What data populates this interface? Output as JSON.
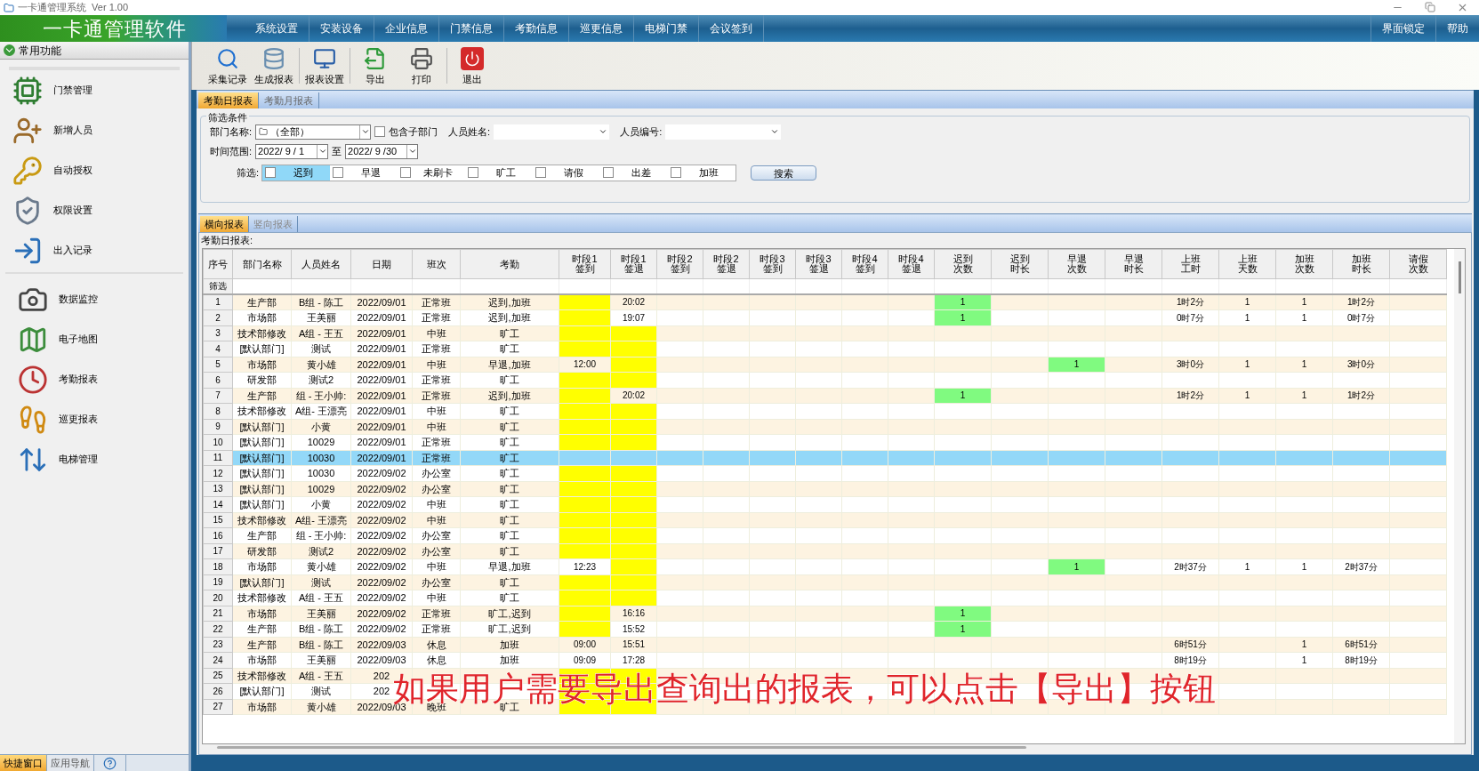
{
  "window": {
    "title": "一卡通管理系统  Ver 1.00"
  },
  "menu": {
    "logo": "一卡通管理软件",
    "items": [
      "系统设置",
      "安装设备",
      "企业信息",
      "门禁信息",
      "考勤信息",
      "巡更信息",
      "电梯门禁",
      "会议签到"
    ],
    "right_items": [
      "界面锁定",
      "帮助"
    ]
  },
  "sidebar": {
    "header": "常用功能",
    "groups": [
      [
        "门禁管理",
        "新增人员",
        "自动授权",
        "权限设置",
        "出入记录"
      ],
      [
        "数据监控",
        "电子地图",
        "考勤报表",
        "巡更报表",
        "电梯管理"
      ]
    ],
    "bottom_tabs": [
      {
        "label": "快捷窗口",
        "selected": true
      },
      {
        "label": "应用导航",
        "selected": false
      }
    ]
  },
  "toolbar": [
    "采集记录",
    "生成报表",
    "报表设置",
    "导出",
    "打印",
    "退出"
  ],
  "report_tabs": [
    {
      "label": "考勤日报表",
      "selected": true
    },
    {
      "label": "考勤月报表",
      "selected": false
    }
  ],
  "filters": {
    "title": "筛选条件",
    "dept_label": "部门名称:",
    "dept_value": "（全部）",
    "include_sub": {
      "label": "包含子部门",
      "checked": false
    },
    "name_label": "人员姓名:",
    "number_label": "人员编号:",
    "range_label": "时间范围:",
    "date_from": "2022/ 9 / 1",
    "to_label": "至",
    "date_to": "2022/ 9 /30",
    "filter_label": "筛选:",
    "options": [
      {
        "label": "迟到",
        "checked": false,
        "highlighted": true
      },
      {
        "label": "早退",
        "checked": false,
        "highlighted": false
      },
      {
        "label": "未刷卡",
        "checked": false,
        "highlighted": false
      },
      {
        "label": "旷工",
        "checked": false,
        "highlighted": false
      },
      {
        "label": "请假",
        "checked": false,
        "highlighted": false
      },
      {
        "label": "出差",
        "checked": false,
        "highlighted": false
      },
      {
        "label": "加班",
        "checked": false,
        "highlighted": false
      }
    ],
    "search_button": "搜索"
  },
  "view_tabs": [
    {
      "label": "横向报表",
      "selected": true
    },
    {
      "label": "竖向报表",
      "selected": false
    }
  ],
  "table": {
    "title": "考勤日报表:",
    "filter_row_label": "筛选",
    "columns": [
      {
        "lines": [
          "序号"
        ]
      },
      {
        "lines": [
          "部门名称"
        ]
      },
      {
        "lines": [
          "人员姓名"
        ]
      },
      {
        "lines": [
          "日期"
        ]
      },
      {
        "lines": [
          "班次"
        ]
      },
      {
        "lines": [
          "考勤"
        ]
      },
      {
        "lines": [
          "时段1",
          "签到"
        ]
      },
      {
        "lines": [
          "时段1",
          "签退"
        ]
      },
      {
        "lines": [
          "时段2",
          "签到"
        ]
      },
      {
        "lines": [
          "时段2",
          "签退"
        ]
      },
      {
        "lines": [
          "时段3",
          "签到"
        ]
      },
      {
        "lines": [
          "时段3",
          "签退"
        ]
      },
      {
        "lines": [
          "时段4",
          "签到"
        ]
      },
      {
        "lines": [
          "时段4",
          "签退"
        ]
      },
      {
        "lines": [
          "迟到",
          "次数"
        ]
      },
      {
        "lines": [
          "迟到",
          "时长"
        ]
      },
      {
        "lines": [
          "早退",
          "次数"
        ]
      },
      {
        "lines": [
          "早退",
          "时长"
        ]
      },
      {
        "lines": [
          "上班",
          "工时"
        ]
      },
      {
        "lines": [
          "上班",
          "天数"
        ]
      },
      {
        "lines": [
          "加班",
          "次数"
        ]
      },
      {
        "lines": [
          "加班",
          "时长"
        ]
      },
      {
        "lines": [
          "请假",
          "次数"
        ]
      }
    ],
    "rows": [
      {
        "selected": false,
        "cells": [
          {
            "text": "1"
          },
          {
            "text": "生产部"
          },
          {
            "text": "B组 - 陈工"
          },
          {
            "text": "2022/09/01"
          },
          {
            "text": "正常班"
          },
          {
            "text": "迟到,加班"
          },
          {
            "color": "#ffff00"
          },
          {
            "text": "20:02"
          },
          {},
          {},
          {},
          {},
          {},
          {},
          {
            "text": "1",
            "color": "#80fa80"
          },
          {},
          {},
          {},
          {
            "text": "1时2分"
          },
          {
            "text": "1"
          },
          {
            "text": "1"
          },
          {
            "text": "1时2分"
          },
          {}
        ]
      },
      {
        "selected": false,
        "cells": [
          {
            "text": "2"
          },
          {
            "text": "市场部"
          },
          {
            "text": "王美丽"
          },
          {
            "text": "2022/09/01"
          },
          {
            "text": "正常班"
          },
          {
            "text": "迟到,加班"
          },
          {
            "color": "#ffff00"
          },
          {
            "text": "19:07"
          },
          {},
          {},
          {},
          {},
          {},
          {},
          {
            "text": "1",
            "color": "#80fa80"
          },
          {},
          {},
          {},
          {
            "text": "0时7分"
          },
          {
            "text": "1"
          },
          {
            "text": "1"
          },
          {
            "text": "0时7分"
          },
          {}
        ]
      },
      {
        "selected": false,
        "cells": [
          {
            "text": "3"
          },
          {
            "text": "技术部修改"
          },
          {
            "text": "A组 - 王五"
          },
          {
            "text": "2022/09/01"
          },
          {
            "text": "中班"
          },
          {
            "text": "旷工"
          },
          {
            "color": "#ffff00"
          },
          {
            "color": "#ffff00"
          },
          {},
          {},
          {},
          {},
          {},
          {},
          {},
          {},
          {},
          {},
          {},
          {},
          {},
          {},
          {}
        ]
      },
      {
        "selected": false,
        "cells": [
          {
            "text": "4"
          },
          {
            "text": "[默认部门]"
          },
          {
            "text": "测试"
          },
          {
            "text": "2022/09/01"
          },
          {
            "text": "正常班"
          },
          {
            "text": "旷工"
          },
          {
            "color": "#ffff00"
          },
          {
            "color": "#ffff00"
          },
          {},
          {},
          {},
          {},
          {},
          {},
          {},
          {},
          {},
          {},
          {},
          {},
          {},
          {},
          {}
        ]
      },
      {
        "selected": false,
        "cells": [
          {
            "text": "5"
          },
          {
            "text": "市场部"
          },
          {
            "text": "黄小雄"
          },
          {
            "text": "2022/09/01"
          },
          {
            "text": "中班"
          },
          {
            "text": "早退,加班"
          },
          {
            "text": "12:00"
          },
          {
            "color": "#ffff00"
          },
          {},
          {},
          {},
          {},
          {},
          {},
          {},
          {},
          {
            "text": "1",
            "color": "#80fa80"
          },
          {},
          {
            "text": "3时0分"
          },
          {
            "text": "1"
          },
          {
            "text": "1"
          },
          {
            "text": "3时0分"
          },
          {}
        ]
      },
      {
        "selected": false,
        "cells": [
          {
            "text": "6"
          },
          {
            "text": "研发部"
          },
          {
            "text": "测试2"
          },
          {
            "text": "2022/09/01"
          },
          {
            "text": "正常班"
          },
          {
            "text": "旷工"
          },
          {
            "color": "#ffff00"
          },
          {
            "color": "#ffff00"
          },
          {},
          {},
          {},
          {},
          {},
          {},
          {},
          {},
          {},
          {},
          {},
          {},
          {},
          {},
          {}
        ]
      },
      {
        "selected": false,
        "cells": [
          {
            "text": "7"
          },
          {
            "text": "生产部"
          },
          {
            "text": "组 - 王小帅:"
          },
          {
            "text": "2022/09/01"
          },
          {
            "text": "正常班"
          },
          {
            "text": "迟到,加班"
          },
          {
            "color": "#ffff00"
          },
          {
            "text": "20:02"
          },
          {},
          {},
          {},
          {},
          {},
          {},
          {
            "text": "1",
            "color": "#80fa80"
          },
          {},
          {},
          {},
          {
            "text": "1时2分"
          },
          {
            "text": "1"
          },
          {
            "text": "1"
          },
          {
            "text": "1时2分"
          },
          {}
        ]
      },
      {
        "selected": false,
        "cells": [
          {
            "text": "8"
          },
          {
            "text": "技术部修改"
          },
          {
            "text": "A组- 王漂亮"
          },
          {
            "text": "2022/09/01"
          },
          {
            "text": "中班"
          },
          {
            "text": "旷工"
          },
          {
            "color": "#ffff00"
          },
          {
            "color": "#ffff00"
          },
          {},
          {},
          {},
          {},
          {},
          {},
          {},
          {},
          {},
          {},
          {},
          {},
          {},
          {},
          {}
        ]
      },
      {
        "selected": false,
        "cells": [
          {
            "text": "9"
          },
          {
            "text": "[默认部门]"
          },
          {
            "text": "小黄"
          },
          {
            "text": "2022/09/01"
          },
          {
            "text": "中班"
          },
          {
            "text": "旷工"
          },
          {
            "color": "#ffff00"
          },
          {
            "color": "#ffff00"
          },
          {},
          {},
          {},
          {},
          {},
          {},
          {},
          {},
          {},
          {},
          {},
          {},
          {},
          {},
          {}
        ]
      },
      {
        "selected": false,
        "cells": [
          {
            "text": "10"
          },
          {
            "text": "[默认部门]"
          },
          {
            "text": "10029"
          },
          {
            "text": "2022/09/01"
          },
          {
            "text": "正常班"
          },
          {
            "text": "旷工"
          },
          {
            "color": "#ffff00"
          },
          {
            "color": "#ffff00"
          },
          {},
          {},
          {},
          {},
          {},
          {},
          {},
          {},
          {},
          {},
          {},
          {},
          {},
          {},
          {}
        ]
      },
      {
        "selected": true,
        "cells": [
          {
            "text": "11"
          },
          {
            "text": "[默认部门]"
          },
          {
            "text": "10030"
          },
          {
            "text": "2022/09/01"
          },
          {
            "text": "正常班"
          },
          {
            "text": "旷工"
          },
          {},
          {},
          {},
          {},
          {},
          {},
          {},
          {},
          {},
          {},
          {},
          {},
          {},
          {},
          {},
          {},
          {}
        ]
      },
      {
        "selected": false,
        "cells": [
          {
            "text": "12"
          },
          {
            "text": "[默认部门]"
          },
          {
            "text": "10030"
          },
          {
            "text": "2022/09/02"
          },
          {
            "text": "办公室"
          },
          {
            "text": "旷工"
          },
          {
            "color": "#ffff00"
          },
          {
            "color": "#ffff00"
          },
          {},
          {},
          {},
          {},
          {},
          {},
          {},
          {},
          {},
          {},
          {},
          {},
          {},
          {},
          {}
        ]
      },
      {
        "selected": false,
        "cells": [
          {
            "text": "13"
          },
          {
            "text": "[默认部门]"
          },
          {
            "text": "10029"
          },
          {
            "text": "2022/09/02"
          },
          {
            "text": "办公室"
          },
          {
            "text": "旷工"
          },
          {
            "color": "#ffff00"
          },
          {
            "color": "#ffff00"
          },
          {},
          {},
          {},
          {},
          {},
          {},
          {},
          {},
          {},
          {},
          {},
          {},
          {},
          {},
          {}
        ]
      },
      {
        "selected": false,
        "cells": [
          {
            "text": "14"
          },
          {
            "text": "[默认部门]"
          },
          {
            "text": "小黄"
          },
          {
            "text": "2022/09/02"
          },
          {
            "text": "中班"
          },
          {
            "text": "旷工"
          },
          {
            "color": "#ffff00"
          },
          {
            "color": "#ffff00"
          },
          {},
          {},
          {},
          {},
          {},
          {},
          {},
          {},
          {},
          {},
          {},
          {},
          {},
          {},
          {}
        ]
      },
      {
        "selected": false,
        "cells": [
          {
            "text": "15"
          },
          {
            "text": "技术部修改"
          },
          {
            "text": "A组- 王漂亮"
          },
          {
            "text": "2022/09/02"
          },
          {
            "text": "中班"
          },
          {
            "text": "旷工"
          },
          {
            "color": "#ffff00"
          },
          {
            "color": "#ffff00"
          },
          {},
          {},
          {},
          {},
          {},
          {},
          {},
          {},
          {},
          {},
          {},
          {},
          {},
          {},
          {}
        ]
      },
      {
        "selected": false,
        "cells": [
          {
            "text": "16"
          },
          {
            "text": "生产部"
          },
          {
            "text": "组 - 王小帅:"
          },
          {
            "text": "2022/09/02"
          },
          {
            "text": "办公室"
          },
          {
            "text": "旷工"
          },
          {
            "color": "#ffff00"
          },
          {
            "color": "#ffff00"
          },
          {},
          {},
          {},
          {},
          {},
          {},
          {},
          {},
          {},
          {},
          {},
          {},
          {},
          {},
          {}
        ]
      },
      {
        "selected": false,
        "cells": [
          {
            "text": "17"
          },
          {
            "text": "研发部"
          },
          {
            "text": "测试2"
          },
          {
            "text": "2022/09/02"
          },
          {
            "text": "办公室"
          },
          {
            "text": "旷工"
          },
          {
            "color": "#ffff00"
          },
          {
            "color": "#ffff00"
          },
          {},
          {},
          {},
          {},
          {},
          {},
          {},
          {},
          {},
          {},
          {},
          {},
          {},
          {},
          {}
        ]
      },
      {
        "selected": false,
        "cells": [
          {
            "text": "18"
          },
          {
            "text": "市场部"
          },
          {
            "text": "黄小雄"
          },
          {
            "text": "2022/09/02"
          },
          {
            "text": "中班"
          },
          {
            "text": "早退,加班"
          },
          {
            "text": "12:23"
          },
          {
            "color": "#ffff00"
          },
          {},
          {},
          {},
          {},
          {},
          {},
          {},
          {},
          {
            "text": "1",
            "color": "#80fa80"
          },
          {},
          {
            "text": "2时37分"
          },
          {
            "text": "1"
          },
          {
            "text": "1"
          },
          {
            "text": "2时37分"
          },
          {}
        ]
      },
      {
        "selected": false,
        "cells": [
          {
            "text": "19"
          },
          {
            "text": "[默认部门]"
          },
          {
            "text": "测试"
          },
          {
            "text": "2022/09/02"
          },
          {
            "text": "办公室"
          },
          {
            "text": "旷工"
          },
          {
            "color": "#ffff00"
          },
          {
            "color": "#ffff00"
          },
          {},
          {},
          {},
          {},
          {},
          {},
          {},
          {},
          {},
          {},
          {},
          {},
          {},
          {},
          {}
        ]
      },
      {
        "selected": false,
        "cells": [
          {
            "text": "20"
          },
          {
            "text": "技术部修改"
          },
          {
            "text": "A组 - 王五"
          },
          {
            "text": "2022/09/02"
          },
          {
            "text": "中班"
          },
          {
            "text": "旷工"
          },
          {
            "color": "#ffff00"
          },
          {
            "color": "#ffff00"
          },
          {},
          {},
          {},
          {},
          {},
          {},
          {},
          {},
          {},
          {},
          {},
          {},
          {},
          {},
          {}
        ]
      },
      {
        "selected": false,
        "cells": [
          {
            "text": "21"
          },
          {
            "text": "市场部"
          },
          {
            "text": "王美丽"
          },
          {
            "text": "2022/09/02"
          },
          {
            "text": "正常班"
          },
          {
            "text": "旷工,迟到"
          },
          {
            "color": "#ffff00"
          },
          {
            "text": "16:16"
          },
          {},
          {},
          {},
          {},
          {},
          {},
          {
            "text": "1",
            "color": "#80fa80"
          },
          {},
          {},
          {},
          {},
          {},
          {},
          {},
          {}
        ]
      },
      {
        "selected": false,
        "cells": [
          {
            "text": "22"
          },
          {
            "text": "生产部"
          },
          {
            "text": "B组 - 陈工"
          },
          {
            "text": "2022/09/02"
          },
          {
            "text": "正常班"
          },
          {
            "text": "旷工,迟到"
          },
          {
            "color": "#ffff00"
          },
          {
            "text": "15:52"
          },
          {},
          {},
          {},
          {},
          {},
          {},
          {
            "text": "1",
            "color": "#80fa80"
          },
          {},
          {},
          {},
          {},
          {},
          {},
          {},
          {}
        ]
      },
      {
        "selected": false,
        "cells": [
          {
            "text": "23"
          },
          {
            "text": "生产部"
          },
          {
            "text": "B组 - 陈工"
          },
          {
            "text": "2022/09/03"
          },
          {
            "text": "休息"
          },
          {
            "text": "加班"
          },
          {
            "text": "09:00"
          },
          {
            "text": "15:51"
          },
          {},
          {},
          {},
          {},
          {},
          {},
          {},
          {},
          {},
          {},
          {
            "text": "6时51分"
          },
          {},
          {
            "text": "1"
          },
          {
            "text": "6时51分"
          },
          {}
        ]
      },
      {
        "selected": false,
        "cells": [
          {
            "text": "24"
          },
          {
            "text": "市场部"
          },
          {
            "text": "王美丽"
          },
          {
            "text": "2022/09/03"
          },
          {
            "text": "休息"
          },
          {
            "text": "加班"
          },
          {
            "text": "09:09"
          },
          {
            "text": "17:28"
          },
          {},
          {},
          {},
          {},
          {},
          {},
          {},
          {},
          {},
          {},
          {
            "text": "8时19分"
          },
          {},
          {
            "text": "1"
          },
          {
            "text": "8时19分"
          },
          {}
        ]
      },
      {
        "selected": false,
        "cells": [
          {
            "text": "25"
          },
          {
            "text": "技术部修改"
          },
          {
            "text": "A组 - 王五"
          },
          {
            "text": "202"
          },
          {},
          {},
          {
            "color": "#ffff00"
          },
          {
            "color": "#ffff00"
          },
          {},
          {},
          {},
          {},
          {},
          {},
          {},
          {},
          {},
          {},
          {},
          {},
          {},
          {},
          {}
        ]
      },
      {
        "selected": false,
        "cells": [
          {
            "text": "26"
          },
          {
            "text": "[默认部门]"
          },
          {
            "text": "测试"
          },
          {
            "text": "202"
          },
          {},
          {},
          {
            "color": "#ffff00"
          },
          {
            "color": "#ffff00"
          },
          {},
          {},
          {},
          {},
          {},
          {},
          {},
          {},
          {},
          {},
          {},
          {},
          {},
          {},
          {}
        ]
      },
      {
        "selected": false,
        "cells": [
          {
            "text": "27"
          },
          {
            "text": "市场部"
          },
          {
            "text": "黄小雄"
          },
          {
            "text": "2022/09/03"
          },
          {
            "text": "晚班"
          },
          {
            "text": "旷工"
          },
          {
            "color": "#ffff00"
          },
          {
            "color": "#ffff00"
          },
          {},
          {},
          {},
          {},
          {},
          {},
          {},
          {},
          {},
          {},
          {},
          {},
          {},
          {},
          {}
        ]
      }
    ]
  },
  "caption": "如果用户需要导出查询出的报表，可以点击【导出】按钮"
}
